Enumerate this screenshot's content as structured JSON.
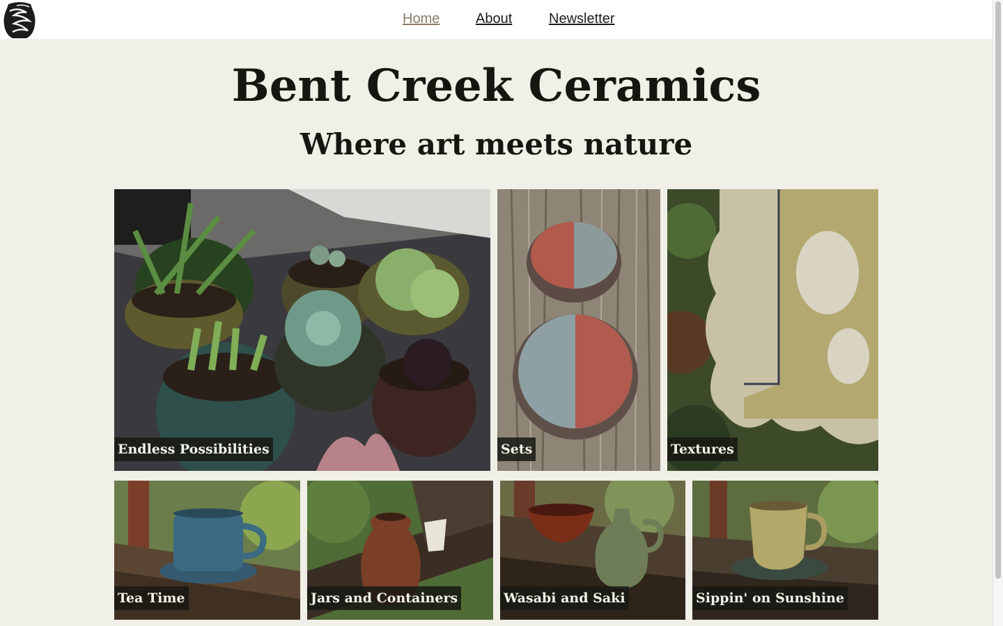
{
  "nav": {
    "items": [
      {
        "label": "Home",
        "active": true
      },
      {
        "label": "About",
        "active": false
      },
      {
        "label": "Newsletter",
        "active": false
      }
    ]
  },
  "hero": {
    "title": "Bent Creek Ceramics",
    "subtitle": "Where art meets nature"
  },
  "gallery": {
    "tiles": [
      {
        "label": "Endless Possibilities"
      },
      {
        "label": "Sets"
      },
      {
        "label": "Textures"
      },
      {
        "label": "Tea Time"
      },
      {
        "label": "Jars and Containers"
      },
      {
        "label": "Wasabi and Saki"
      },
      {
        "label": "Sippin' on Sunshine"
      }
    ]
  },
  "colors": {
    "background": "#f0efe8",
    "nav_active": "#8a7a67",
    "text": "#161611",
    "label_bg": "#181814"
  }
}
